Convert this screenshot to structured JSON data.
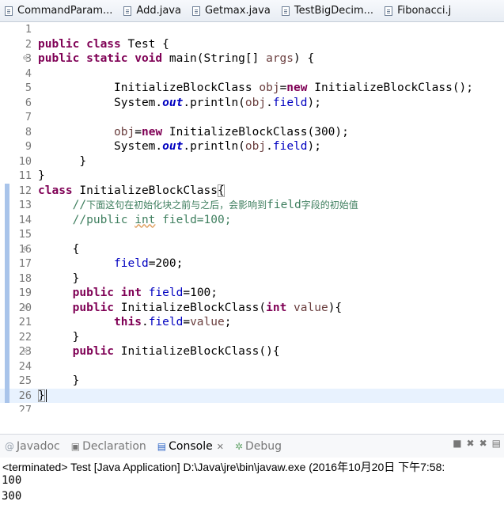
{
  "tabs": [
    {
      "label": "CommandParam..."
    },
    {
      "label": "Add.java"
    },
    {
      "label": "Getmax.java"
    },
    {
      "label": "TestBigDecim..."
    },
    {
      "label": "Fibonacci.j"
    }
  ],
  "editor": {
    "lines": [
      {
        "num": "1",
        "fold": "",
        "segs": []
      },
      {
        "num": "2",
        "fold": "",
        "segs": [
          {
            "t": "public class",
            "c": "kw"
          },
          {
            "t": " Test {"
          }
        ]
      },
      {
        "num": "3",
        "fold": "⊖",
        "segs": [
          {
            "t": "public static void",
            "c": "kw"
          },
          {
            "t": " main(String[] "
          },
          {
            "t": "args",
            "c": "param"
          },
          {
            "t": ") {"
          }
        ]
      },
      {
        "num": "4",
        "fold": "",
        "segs": []
      },
      {
        "num": "5",
        "fold": "",
        "segs": [
          {
            "t": "           InitializeBlockClass "
          },
          {
            "t": "obj",
            "c": "param"
          },
          {
            "t": "="
          },
          {
            "t": "new",
            "c": "kw"
          },
          {
            "t": " InitializeBlockClass();"
          }
        ]
      },
      {
        "num": "6",
        "fold": "",
        "segs": [
          {
            "t": "           System."
          },
          {
            "t": "out",
            "c": "out"
          },
          {
            "t": ".println("
          },
          {
            "t": "obj",
            "c": "param"
          },
          {
            "t": "."
          },
          {
            "t": "field",
            "c": "fld"
          },
          {
            "t": ");"
          }
        ]
      },
      {
        "num": "7",
        "fold": "",
        "segs": []
      },
      {
        "num": "8",
        "fold": "",
        "segs": [
          {
            "t": "           "
          },
          {
            "t": "obj",
            "c": "param"
          },
          {
            "t": "="
          },
          {
            "t": "new",
            "c": "kw"
          },
          {
            "t": " InitializeBlockClass(300);"
          }
        ]
      },
      {
        "num": "9",
        "fold": "",
        "segs": [
          {
            "t": "           System."
          },
          {
            "t": "out",
            "c": "out"
          },
          {
            "t": ".println("
          },
          {
            "t": "obj",
            "c": "param"
          },
          {
            "t": "."
          },
          {
            "t": "field",
            "c": "fld"
          },
          {
            "t": ");"
          }
        ]
      },
      {
        "num": "10",
        "fold": "",
        "segs": [
          {
            "t": "      }"
          }
        ]
      },
      {
        "num": "11",
        "fold": "",
        "segs": [
          {
            "t": "}"
          }
        ]
      },
      {
        "num": "12",
        "fold": "",
        "mark": true,
        "segs": [
          {
            "t": "class",
            "c": "kw"
          },
          {
            "t": " InitializeBlockClass"
          },
          {
            "t": "{",
            "c": "sel-brace"
          }
        ]
      },
      {
        "num": "13",
        "fold": "",
        "mark": true,
        "segs": [
          {
            "t": "     //",
            "c": "cm"
          },
          {
            "t": "下面这句在初始化块之前与之后，会影响到",
            "c": "cm cm-cjk"
          },
          {
            "t": "field",
            "c": "cm"
          },
          {
            "t": "字段的初始值",
            "c": "cm cm-cjk"
          }
        ]
      },
      {
        "num": "14",
        "fold": "",
        "mark": true,
        "segs": [
          {
            "t": "     //public ",
            "c": "cm"
          },
          {
            "t": "int",
            "c": "cm warn"
          },
          {
            "t": " field=100;",
            "c": "cm"
          }
        ]
      },
      {
        "num": "15",
        "fold": "",
        "mark": true,
        "segs": []
      },
      {
        "num": "16",
        "fold": "⊖",
        "mark": true,
        "segs": [
          {
            "t": "     {"
          }
        ]
      },
      {
        "num": "17",
        "fold": "",
        "mark": true,
        "segs": [
          {
            "t": "           "
          },
          {
            "t": "field",
            "c": "fld"
          },
          {
            "t": "=200;"
          }
        ]
      },
      {
        "num": "18",
        "fold": "",
        "mark": true,
        "segs": [
          {
            "t": "     }"
          }
        ]
      },
      {
        "num": "19",
        "fold": "",
        "mark": true,
        "segs": [
          {
            "t": "     "
          },
          {
            "t": "public int",
            "c": "kw"
          },
          {
            "t": " "
          },
          {
            "t": "field",
            "c": "fld"
          },
          {
            "t": "=100;"
          }
        ]
      },
      {
        "num": "20",
        "fold": "⊖",
        "mark": true,
        "segs": [
          {
            "t": "     "
          },
          {
            "t": "public",
            "c": "kw"
          },
          {
            "t": " InitializeBlockClass("
          },
          {
            "t": "int",
            "c": "kw"
          },
          {
            "t": " "
          },
          {
            "t": "value",
            "c": "param"
          },
          {
            "t": "){"
          }
        ]
      },
      {
        "num": "21",
        "fold": "",
        "mark": true,
        "segs": [
          {
            "t": "           "
          },
          {
            "t": "this",
            "c": "kw"
          },
          {
            "t": "."
          },
          {
            "t": "field",
            "c": "fld"
          },
          {
            "t": "="
          },
          {
            "t": "value",
            "c": "param"
          },
          {
            "t": ";"
          }
        ]
      },
      {
        "num": "22",
        "fold": "",
        "mark": true,
        "segs": [
          {
            "t": "     }"
          }
        ]
      },
      {
        "num": "23",
        "fold": "⊖",
        "mark": true,
        "segs": [
          {
            "t": "     "
          },
          {
            "t": "public",
            "c": "kw"
          },
          {
            "t": " InitializeBlockClass(){"
          }
        ]
      },
      {
        "num": "24",
        "fold": "",
        "mark": true,
        "segs": []
      },
      {
        "num": "25",
        "fold": "",
        "mark": true,
        "segs": [
          {
            "t": "     }"
          }
        ]
      },
      {
        "num": "26",
        "fold": "",
        "mark": true,
        "cur": true,
        "segs": [
          {
            "t": "}",
            "c": "sel-brace"
          },
          {
            "t": "",
            "c": "caret"
          }
        ]
      },
      {
        "num": "27",
        "fold": "",
        "segs": []
      }
    ],
    "scroll_left_glyph": "‹"
  },
  "console": {
    "tabs": [
      {
        "label": "Javadoc",
        "icon": "javadoc-icon",
        "glyph": "@",
        "active": false
      },
      {
        "label": "Declaration",
        "icon": "declaration-icon",
        "glyph": "▣",
        "active": false
      },
      {
        "label": "Console",
        "icon": "console-icon",
        "glyph": "▤",
        "active": true,
        "close": "✕"
      },
      {
        "label": "Debug",
        "icon": "debug-icon",
        "glyph": "✲",
        "active": false
      }
    ],
    "toolbar_glyphs": [
      "■",
      "✖",
      "✖",
      "▤"
    ],
    "status": "<terminated> Test [Java Application] D:\\Java\\jre\\bin\\javaw.exe (2016年10月20日 下午7:58:",
    "output": [
      "100",
      "300"
    ]
  }
}
